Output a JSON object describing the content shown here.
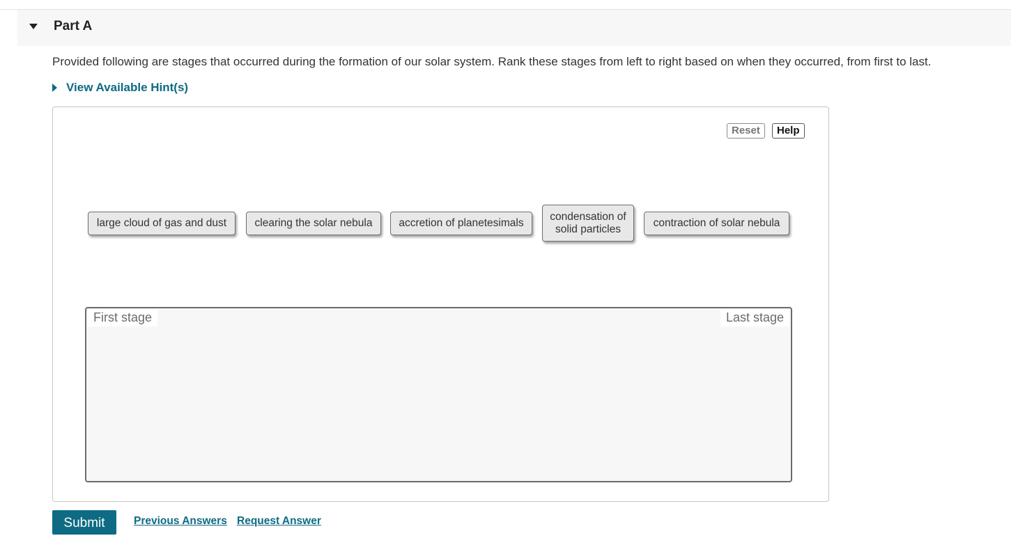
{
  "part": {
    "title": "Part A",
    "collapse_icon": "caret-down-icon"
  },
  "question": {
    "prompt": "Provided following are stages that occurred during the formation of our solar system. Rank these stages from left to right based on when they occurred, from first to last.",
    "hint_label": "View Available Hint(s)",
    "hint_icon": "caret-right-icon"
  },
  "toolbar": {
    "reset_label": "Reset",
    "help_label": "Help"
  },
  "tiles": [
    {
      "label": "large cloud of gas and dust"
    },
    {
      "label": "clearing the solar nebula"
    },
    {
      "label": "accretion of planetesimals"
    },
    {
      "label": "condensation of solid particles"
    },
    {
      "label": "contraction of solar nebula"
    }
  ],
  "dropzone": {
    "first_label": "First stage",
    "last_label": "Last stage"
  },
  "actions": {
    "submit_label": "Submit",
    "previous_answers_label": "Previous Answers",
    "request_answer_label": "Request Answer"
  },
  "colors": {
    "accent": "#0e6b83",
    "tile_bg": "#e8e8e8",
    "zone_bg": "#f7f7f7"
  }
}
